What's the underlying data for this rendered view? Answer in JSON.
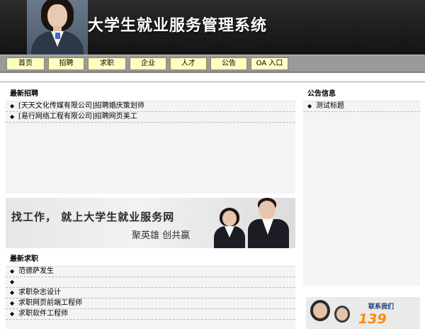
{
  "header": {
    "title": "大学生就业服务管理系统"
  },
  "nav": {
    "items": [
      "首页",
      "招聘",
      "求职",
      "企业",
      "人才",
      "公告",
      "OA 入口"
    ]
  },
  "recruit": {
    "heading": "最新招聘",
    "items": [
      "[天天文化传媒有限公司]招聘婚庆策划师",
      "[易行网络工程有限公司]招聘网页美工"
    ]
  },
  "notice": {
    "heading": "公告信息",
    "items": [
      "测试标题"
    ]
  },
  "banner": {
    "main": "找工作， 就上大学生就业服务网",
    "sub": "聚英雄 创共赢"
  },
  "jobseek": {
    "heading": "最新求职",
    "items": [
      "范德萨发生",
      "",
      "求职杂志设计",
      "求职网页前端工程师",
      "求职软件工程师"
    ]
  },
  "contact": {
    "label": "联系我们",
    "number": "139"
  },
  "colors": {
    "nav_button": "#ffffc4",
    "nav_bar": "#9a9a9a",
    "panel_bg": "#f4f4f4",
    "contact_number": "#ff8a00"
  }
}
